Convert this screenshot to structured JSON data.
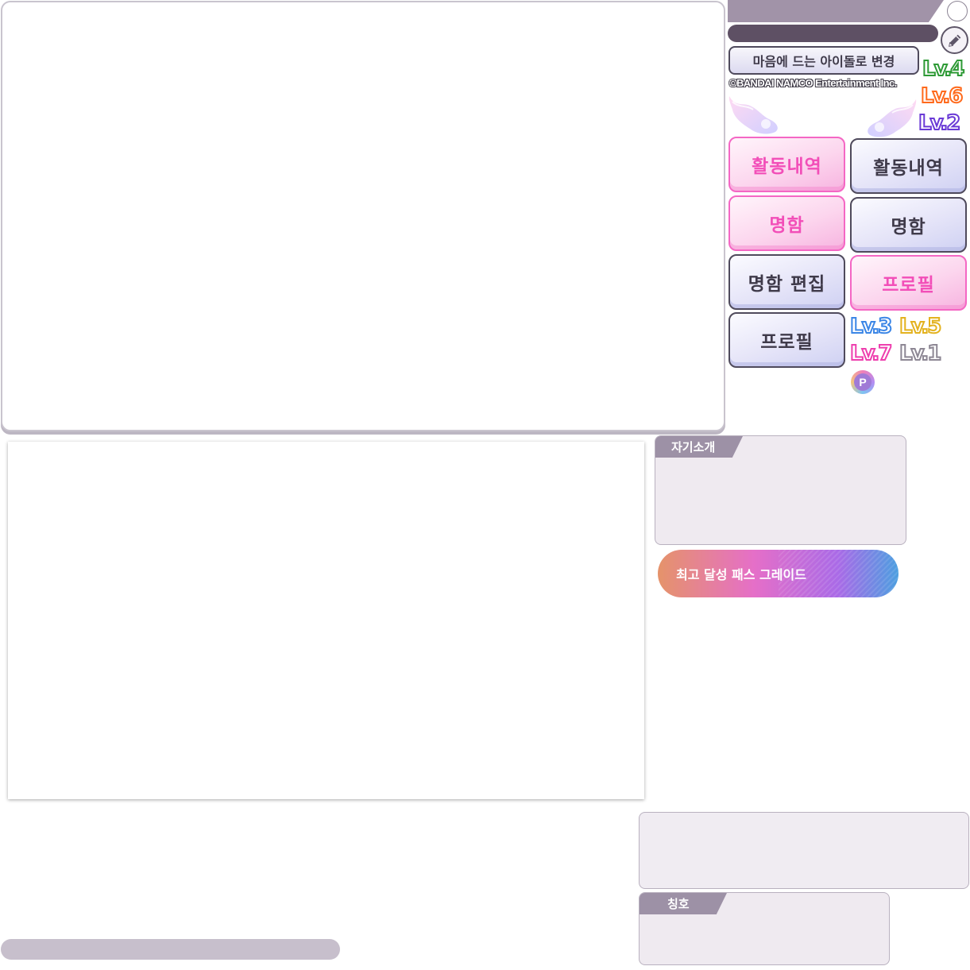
{
  "header": {
    "change_idol_label": "마음에 드는 아이돌로 변경",
    "copyright": "©BANDAI NAMCO Entertainment Inc."
  },
  "level_badges": [
    {
      "text": "Lv.4",
      "color": "#2e9a36"
    },
    {
      "text": "Lv.6",
      "color": "#ff6a1c"
    },
    {
      "text": "Lv.2",
      "color": "#6a3ad6"
    },
    {
      "text": "Lv.3",
      "color": "#3b86e6"
    },
    {
      "text": "Lv.5",
      "color": "#e3b21f"
    },
    {
      "text": "Lv.7",
      "color": "#ee3fae"
    },
    {
      "text": "Lv.1",
      "color": "#8d8794"
    }
  ],
  "buttons": {
    "activity_pink": "활동내역",
    "activity_dark": "활동내역",
    "namecard_pink": "명함",
    "namecard_dark": "명함",
    "namecard_edit": "명함 편집",
    "profile_pink": "프로필",
    "profile_dark": "프로필"
  },
  "point_badge": "P",
  "self_intro_tab": "자기소개",
  "pass_grade_button": "최고 달성 패스 그레이드",
  "title_tab": "칭호",
  "icons": {
    "edit": "pencil-icon",
    "wings": "wing-icon",
    "circle": "circle-button-icon"
  },
  "colors": {
    "pink_accent": "#f24eb8",
    "dark_outline": "#4f4a5c",
    "panel_purple": "#9d91a6"
  }
}
